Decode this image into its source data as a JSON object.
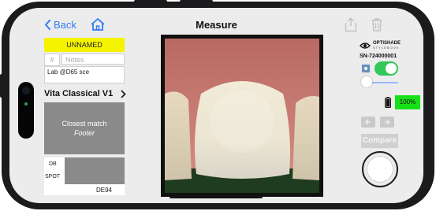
{
  "header": {
    "back_label": "Back",
    "title": "Measure"
  },
  "sample": {
    "name": "UNNAMED",
    "number_placeholder": "#",
    "notes_placeholder": "Notes",
    "color_space": "Lab @D65 sce"
  },
  "shade_guide": {
    "label": "Vita Classical V1"
  },
  "match": {
    "title": "Closest match",
    "subtitle": "Footer"
  },
  "compare_panel": {
    "db_label": "DB",
    "spot_label": "SPOT",
    "metric_label": "DE94"
  },
  "device": {
    "brand": "OPTISHADE",
    "brand_sub": "STYLEBOOK",
    "serial": "SN-724000001",
    "battery": "100%",
    "light_on": true,
    "slider_level": 0.0
  },
  "actions": {
    "compare_label": "Compare"
  },
  "colors": {
    "accent": "#2f7cf6",
    "toggle_green": "#34c759",
    "battery_green": "#18e018",
    "sample_yellow": "#f6f300",
    "swatch_gray": "#8a8a8a"
  }
}
